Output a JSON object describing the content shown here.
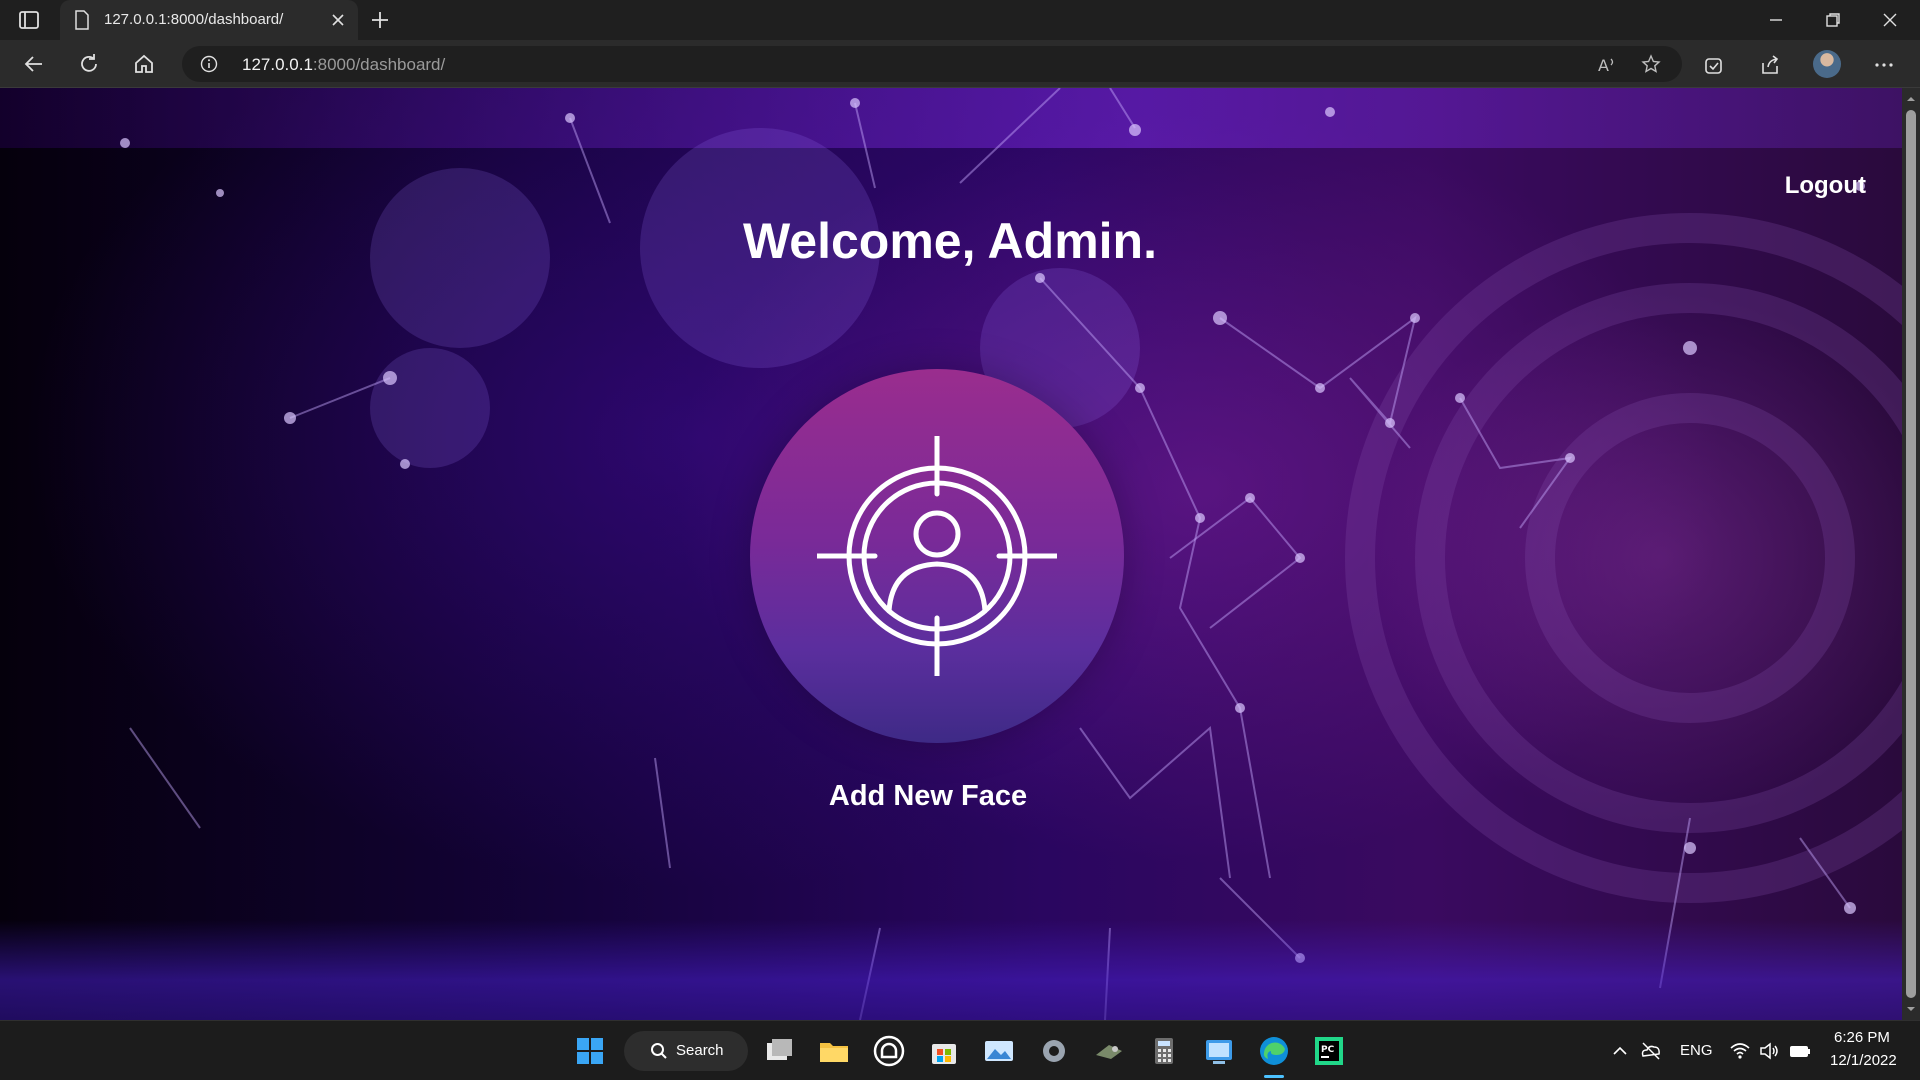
{
  "browser": {
    "tab_title": "127.0.0.1:8000/dashboard/",
    "url_host": "127.0.0.1",
    "url_rest": ":8000/dashboard/"
  },
  "page": {
    "logout_label": "Logout",
    "welcome_text": "Welcome, Admin.",
    "add_face_label": "Add New Face",
    "accent_gradient_top": "#9a2d8e",
    "accent_gradient_bottom": "#3e2a86"
  },
  "taskbar": {
    "search_label": "Search",
    "language": "ENG",
    "time": "6:26 PM",
    "date": "12/1/2022",
    "icons": [
      "start-icon",
      "search-icon",
      "task-view-icon",
      "file-explorer-icon",
      "app-icon",
      "store-icon",
      "photos-icon",
      "settings-icon",
      "app-icon",
      "calculator-icon",
      "app-icon",
      "edge-icon",
      "pycharm-icon"
    ]
  }
}
